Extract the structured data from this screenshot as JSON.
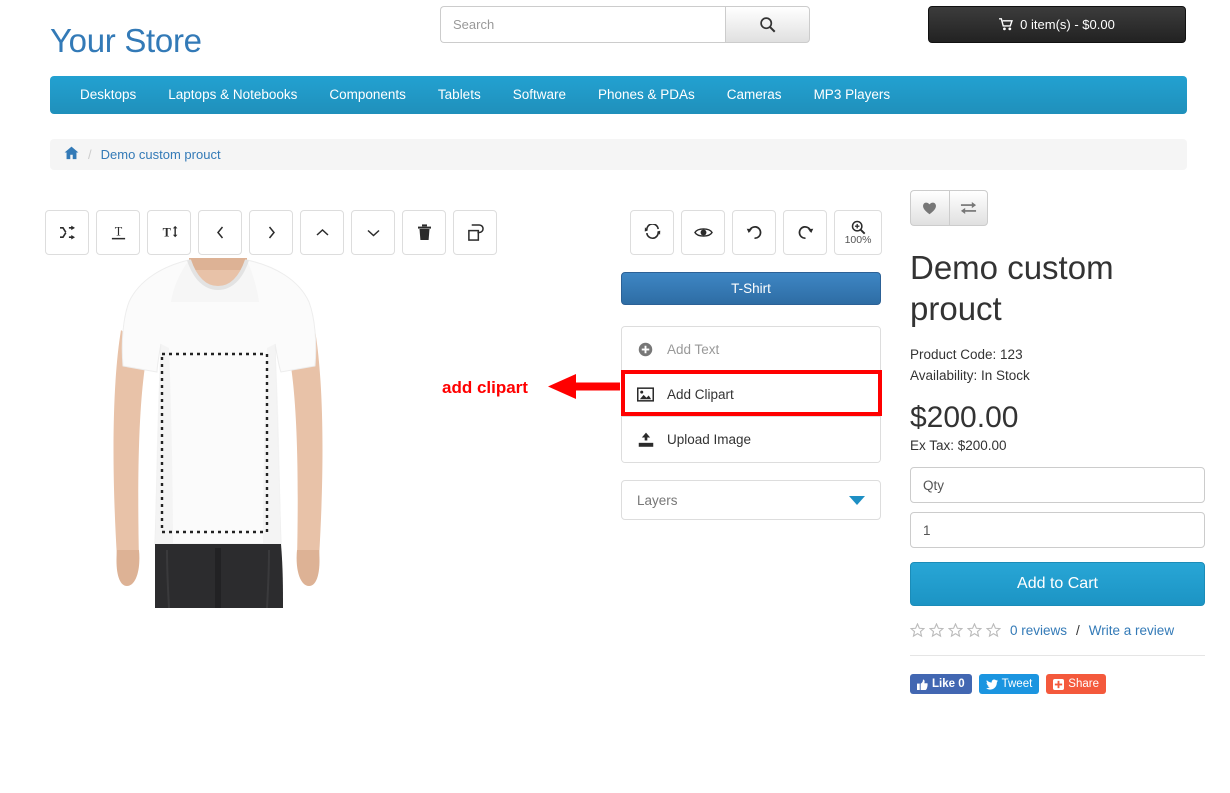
{
  "header": {
    "logo": "Your Store",
    "search": {
      "placeholder": "Search",
      "value": "",
      "icon": "search-icon"
    },
    "cart": {
      "label": "0 item(s) - $0.00",
      "icon": "shopping-cart-icon"
    }
  },
  "nav": {
    "items": [
      {
        "label": "Desktops"
      },
      {
        "label": "Laptops & Notebooks"
      },
      {
        "label": "Components"
      },
      {
        "label": "Tablets"
      },
      {
        "label": "Software"
      },
      {
        "label": "Phones & PDAs"
      },
      {
        "label": "Cameras"
      },
      {
        "label": "MP3 Players"
      }
    ],
    "accent_color": "#23a1d1"
  },
  "breadcrumb": {
    "home_icon": "home-icon",
    "separator": "/",
    "current": "Demo custom prouct"
  },
  "designer": {
    "left_toolbar": [
      {
        "name": "shuffle-icon",
        "title": "shuffle"
      },
      {
        "name": "text-underline-icon",
        "title": "text underline"
      },
      {
        "name": "text-height-icon",
        "title": "text height"
      },
      {
        "name": "chevron-left-icon",
        "title": "move left"
      },
      {
        "name": "chevron-right-icon",
        "title": "move right"
      },
      {
        "name": "chevron-up-icon",
        "title": "move up"
      },
      {
        "name": "chevron-down-icon",
        "title": "move down"
      },
      {
        "name": "trash-icon",
        "title": "delete"
      },
      {
        "name": "clone-icon",
        "title": "clone"
      }
    ],
    "right_toolbar": [
      {
        "name": "refresh-icon",
        "title": "refresh"
      },
      {
        "name": "eye-icon",
        "title": "preview"
      },
      {
        "name": "undo-icon",
        "title": "undo"
      },
      {
        "name": "redo-icon",
        "title": "redo"
      },
      {
        "name": "zoom-in-icon",
        "title": "zoom",
        "label": "100%"
      }
    ],
    "product_tab": "T-Shirt",
    "actions": [
      {
        "label": "Add Text",
        "icon": "plus-circle-icon",
        "state": "muted"
      },
      {
        "label": "Add Clipart",
        "icon": "image-icon",
        "state": "highlighted"
      },
      {
        "label": "Upload Image",
        "icon": "upload-icon",
        "state": "normal"
      }
    ],
    "layers": {
      "label": "Layers",
      "caret_icon": "caret-down-icon",
      "caret_color": "#1d8fc4"
    },
    "canvas": {
      "alt": "white t-shirt mockup with dotted print area"
    }
  },
  "annotation": {
    "text": "add clipart",
    "color": "#ff0000",
    "arrow_icon": "left-arrow-icon"
  },
  "product": {
    "wishlist_icon": "heart-icon",
    "compare_icon": "exchange-icon",
    "title": "Demo custom prouct",
    "product_code_label": "Product Code: 123",
    "availability_label": "Availability: In Stock",
    "price": "$200.00",
    "ex_tax": "Ex Tax: $200.00",
    "qty_label": "Qty",
    "qty_value": "1",
    "add_to_cart": "Add to Cart",
    "stars": 0,
    "max_stars": 5,
    "reviews_link": "0 reviews",
    "reviews_separator": "/",
    "write_review_link": "Write a review",
    "accent_color": "#28a6d6"
  },
  "social": [
    {
      "label": "Like 0",
      "icon": "thumbs-up-icon",
      "color": "#4267b2",
      "name": "facebook-like-button"
    },
    {
      "label": "Tweet",
      "icon": "twitter-bird-icon",
      "color": "#1b95e0",
      "name": "twitter-tweet-button"
    },
    {
      "label": "Share",
      "icon": "google-plus-icon",
      "color": "#f4593c",
      "name": "share-button"
    }
  ]
}
